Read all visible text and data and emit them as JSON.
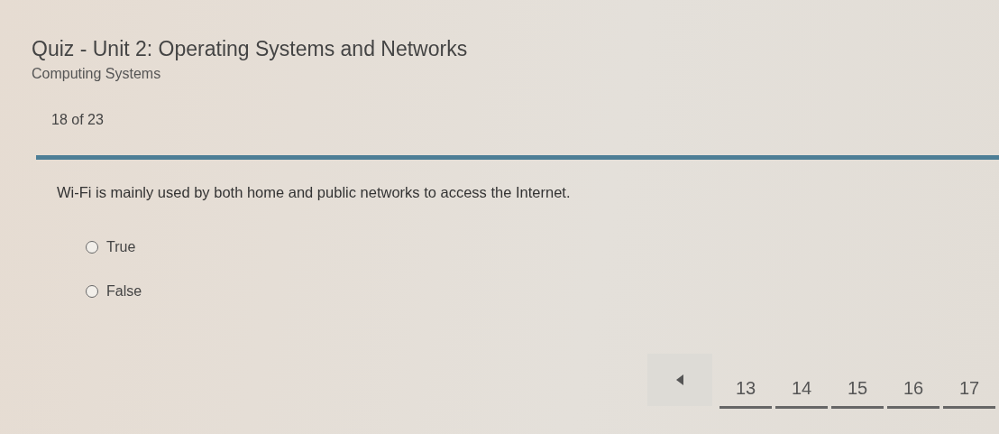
{
  "header": {
    "title": "Quiz - Unit 2: Operating Systems and Networks",
    "subtitle": "Computing Systems",
    "progress": "18 of 23"
  },
  "question": {
    "text": "Wi-Fi is mainly used by both home and public networks to access the Internet.",
    "options": [
      {
        "label": "True",
        "selected": false
      },
      {
        "label": "False",
        "selected": false
      }
    ]
  },
  "pager": {
    "pages": [
      "13",
      "14",
      "15",
      "16",
      "17"
    ]
  }
}
